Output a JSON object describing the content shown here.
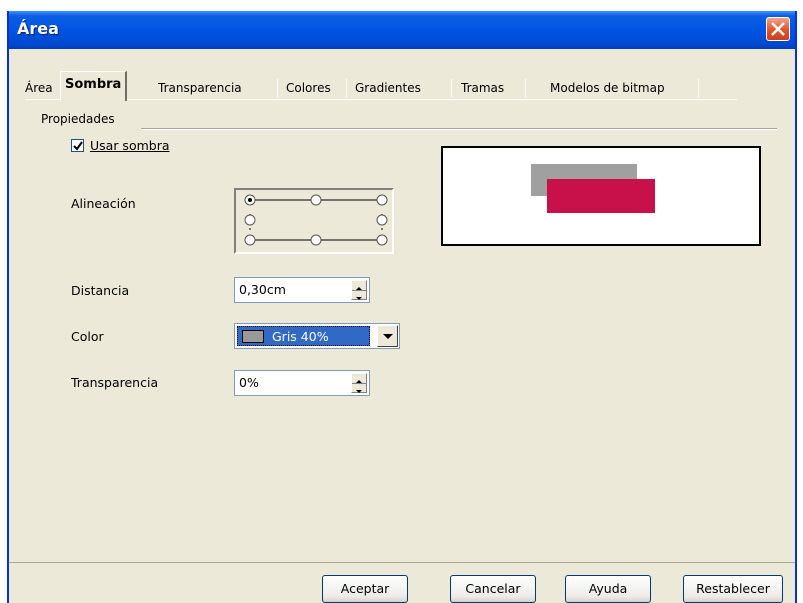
{
  "window": {
    "title": "Área"
  },
  "tabs": [
    {
      "label": "Área"
    },
    {
      "label": "Sombra"
    },
    {
      "label": "Transparencia"
    },
    {
      "label": "Colores"
    },
    {
      "label": "Gradientes"
    },
    {
      "label": "Tramas"
    },
    {
      "label": "Modelos de bitmap"
    }
  ],
  "properties": {
    "group_label": "Propiedades",
    "use_shadow": {
      "label": "Usar sombra",
      "checked": true
    },
    "alignment": {
      "label": "Alineación",
      "selected": "top-left"
    },
    "distance": {
      "label": "Distancia",
      "value": "0,30cm"
    },
    "color": {
      "label": "Color",
      "value": "Gris 40%",
      "swatch_color": "#999999"
    },
    "transparency": {
      "label": "Transparencia",
      "value": "0%"
    }
  },
  "preview": {
    "shadow_color": "#a0a0a0",
    "object_color": "#c8104a"
  },
  "buttons": {
    "accept": "Aceptar",
    "cancel": "Cancelar",
    "help": "Ayuda",
    "reset": "Restablecer"
  },
  "icons": {
    "close": "close-icon",
    "spin_up": "spin-up-icon",
    "spin_down": "spin-down-icon",
    "dropdown": "dropdown-arrow-icon",
    "checkmark": "checkmark-icon"
  }
}
